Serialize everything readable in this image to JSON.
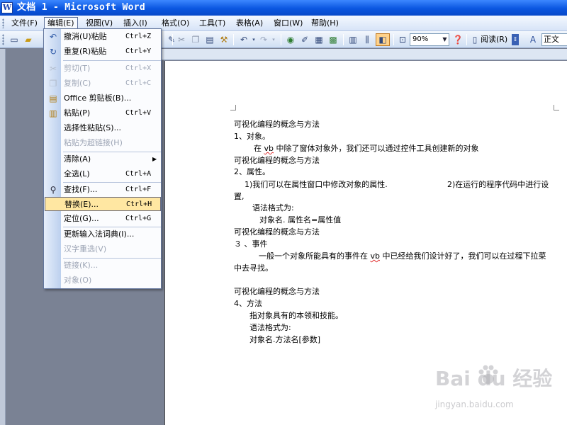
{
  "window": {
    "title": "文档 1 - Microsoft Word",
    "icon": "word-doc-icon"
  },
  "menubar": {
    "items": [
      {
        "label": "文件(F)"
      },
      {
        "label": "编辑(E)"
      },
      {
        "label": "视图(V)"
      },
      {
        "label": "插入(I)"
      },
      {
        "label": "格式(O)"
      },
      {
        "label": "工具(T)"
      },
      {
        "label": "表格(A)"
      },
      {
        "label": "窗口(W)"
      },
      {
        "label": "帮助(H)"
      }
    ]
  },
  "toolbar": {
    "zoom": "90%",
    "read_label": "阅读(R)",
    "style": "正文",
    "icons": [
      "new-doc-icon",
      "open-icon",
      "save-icon",
      "print-icon",
      "cut-icon",
      "copy-icon",
      "paste-icon",
      "format-painter-icon",
      "undo-icon",
      "redo-icon",
      "hyperlink-icon",
      "tables-borders-icon",
      "insert-table-icon",
      "insert-excel-icon",
      "columns-icon",
      "drawing-icon",
      "document-map-icon",
      "show-hide-icon",
      "help-icon",
      "read-icon"
    ]
  },
  "edit_menu": {
    "items": [
      {
        "icon": "undo-icon",
        "label": "撤消(U)粘贴",
        "shortcut": "Ctrl+Z",
        "disabled": false
      },
      {
        "icon": "redo-icon",
        "label": "重复(R)粘贴",
        "shortcut": "Ctrl+Y",
        "disabled": false
      },
      {
        "icon": "cut-icon",
        "label": "剪切(T)",
        "shortcut": "Ctrl+X",
        "disabled": true
      },
      {
        "icon": "copy-icon",
        "label": "复制(C)",
        "shortcut": "Ctrl+C",
        "disabled": true
      },
      {
        "icon": "office-clipboard-icon",
        "label": "Office 剪贴板(B)...",
        "shortcut": "",
        "disabled": false
      },
      {
        "icon": "paste-icon",
        "label": "粘贴(P)",
        "shortcut": "Ctrl+V",
        "disabled": false
      },
      {
        "icon": "",
        "label": "选择性粘贴(S)...",
        "shortcut": "",
        "disabled": false
      },
      {
        "icon": "",
        "label": "粘贴为超链接(H)",
        "shortcut": "",
        "disabled": true
      },
      {
        "icon": "",
        "label": "清除(A)",
        "shortcut": "",
        "disabled": false,
        "submenu": true
      },
      {
        "icon": "",
        "label": "全选(L)",
        "shortcut": "Ctrl+A",
        "disabled": false
      },
      {
        "icon": "find-icon",
        "label": "查找(F)...",
        "shortcut": "Ctrl+F",
        "disabled": false
      },
      {
        "icon": "",
        "label": "替换(E)...",
        "shortcut": "Ctrl+H",
        "disabled": false,
        "selected": true
      },
      {
        "icon": "",
        "label": "定位(G)...",
        "shortcut": "Ctrl+G",
        "disabled": false
      },
      {
        "icon": "",
        "label": "更新输入法词典(I)...",
        "shortcut": "",
        "disabled": false
      },
      {
        "icon": "",
        "label": "汉字重选(V)",
        "shortcut": "",
        "disabled": true
      },
      {
        "icon": "",
        "label": "链接(K)...",
        "shortcut": "",
        "disabled": true
      },
      {
        "icon": "",
        "label": "对象(O)",
        "shortcut": "",
        "disabled": true
      }
    ]
  },
  "document": {
    "lines": [
      "可视化编程的概念与方法",
      "1、对象。",
      "在 vb 中除了窗体对象外，我们还可以通过控件工具创建新的对象",
      "可视化编程的概念与方法",
      "2、属性。",
      "1)我们可以在属性窗口中修改对象的属性.",
      "2)在运行的程序代码中进行设",
      "置,",
      "语法格式为:",
      "对象名. 属性名=属性值",
      "可视化编程的概念与方法",
      "３ 、事件",
      "一般一个对象所能具有的事件在 vb 中已经给我们设计好了，我们可以在过程下拉菜",
      "中去寻找。",
      "可视化编程的概念与方法",
      "4、方法",
      "指对象具有的本领和技能。",
      "语法格式为:",
      "对象名.方法名[参数]"
    ]
  },
  "watermark": {
    "logo": "Bai du 经验",
    "url": "jingyan.baidu.com"
  }
}
